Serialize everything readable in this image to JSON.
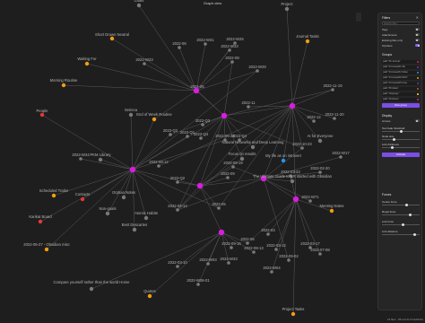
{
  "window": {
    "title": "Graph view",
    "tab_title": "Projects"
  },
  "status_bar": "16 files · 85 words 0 backlinks",
  "panel": {
    "filters": {
      "title": "Filters",
      "search_placeholder": "Search files...",
      "tags": "Tags",
      "attachments": "Attachments",
      "existing_only": "Existing files only",
      "orphans": "Orphans",
      "tags_on": false,
      "attachments_on": false,
      "existing_on": false,
      "orphans_on": true
    },
    "groups": {
      "title": "Groups",
      "items": [
        {
          "label": "path:\"00 Journal\"",
          "color": "#e91e63"
        },
        {
          "label": "path:\"04 Areas/01 Wo",
          "color": "#9c27b0"
        },
        {
          "label": "path:\"04 Areas/04 Video",
          "color": "#2196f3"
        },
        {
          "label": "path:\"04 Areas/06 MOC\"",
          "color": "#ff9800"
        },
        {
          "label": "path:\"04 Areas/05 Crea",
          "color": "#3f51b5"
        },
        {
          "label": "path:\"05 Ideas\"",
          "color": "#f44336"
        },
        {
          "label": "path:\"Clippings\"",
          "color": "#ffeb3b"
        },
        {
          "label": "path:\"03 Notes\"",
          "color": "#e91e63"
        }
      ],
      "new_group": "New group"
    },
    "display": {
      "title": "Display",
      "arrows": "Arrows",
      "text_fade": "Text fade threshold",
      "node_size": "Node size",
      "link_thickness": "Link thickness",
      "animate": "Animate"
    },
    "forces": {
      "title": "Forces",
      "center": "Center force",
      "repel": "Repel force",
      "link_force": "Link force",
      "link_distance": "Link distance"
    }
  },
  "nodes": [
    {
      "label": "Goals",
      "color": "#7a7a7a"
    },
    {
      "label": "Short Drawn Neutral",
      "color": "#f39c12"
    },
    {
      "label": "Journal Tasks",
      "color": "#f39c12"
    },
    {
      "label": "Waiting For",
      "color": "#f39c12"
    },
    {
      "label": "Morning Routine",
      "color": "#f39c12"
    },
    {
      "label": "People",
      "color": "#e53935"
    },
    {
      "label": "Serieca",
      "color": "#7a7a7a"
    },
    {
      "label": "End of Week Routine",
      "color": "#f39c12"
    },
    {
      "label": "PKM Library",
      "color": "#7a7a7a"
    },
    {
      "label": "Contacts",
      "color": "#e53935"
    },
    {
      "label": "Scheduled Trailer",
      "color": "#f39c12"
    },
    {
      "label": "Orphan Notes",
      "color": "#7a7a7a"
    },
    {
      "label": "Atomic Habits",
      "color": "#7a7a7a"
    },
    {
      "label": "Non-goals",
      "color": "#7a7a7a"
    },
    {
      "label": "Karikat Board",
      "color": "#e53935"
    },
    {
      "label": "Best Descartes",
      "color": "#7a7a7a"
    },
    {
      "label": "2022-05-27 - Obsidian misc",
      "color": "#f39c12"
    },
    {
      "label": "Compare yourself rather than the world Home",
      "color": "#7a7a7a"
    },
    {
      "label": "Quotes",
      "color": "#f39c12"
    },
    {
      "label": "Natural Networks and Deep Learning",
      "color": "#7a7a7a"
    },
    {
      "label": "Focus on results",
      "color": "#7a7a7a"
    },
    {
      "label": "My life as an introvert",
      "color": "#2196f3"
    },
    {
      "label": "AI for Everyone",
      "color": "#7a7a7a"
    },
    {
      "label": "The Ultimate Guide to get started with Obsidian",
      "color": "#7a7a7a"
    },
    {
      "label": "Meeting Notes",
      "color": "#f39c12"
    },
    {
      "label": "Project Tasks",
      "color": "#f39c12"
    },
    {
      "label": "Project",
      "color": "#7a7a7a"
    }
  ],
  "date_labels": [
    "2022-06",
    "2022-W31",
    "2022-W33",
    "2022-W25",
    "2022-W23",
    "2022-05",
    "2022-08",
    "2022-W29",
    "2022-Q2",
    "2022-11-19",
    "2022-Q3",
    "2022-Q4",
    "2022-06-22",
    "2022-Q1",
    "2022-W34",
    "2022-11-20",
    "2022-11",
    "2022-12",
    "2022-08-12",
    "2022-10-23",
    "2022-04-14",
    "2022-Q4",
    "2023-05",
    "2022-W71",
    "2022-09",
    "2022-Q2",
    "2022-08-19",
    "2022-09-16",
    "2022-06",
    "2022-03",
    "2022-W04",
    "2022-03-10",
    "2022-W33",
    "2022-W06-01",
    "2022-W03",
    "2022-08-13",
    "2022-03-17",
    "2022-03-14",
    "2022-07-08",
    "2022-09-02",
    "2022-03-23",
    "2022-02-20",
    "2022-W17"
  ]
}
